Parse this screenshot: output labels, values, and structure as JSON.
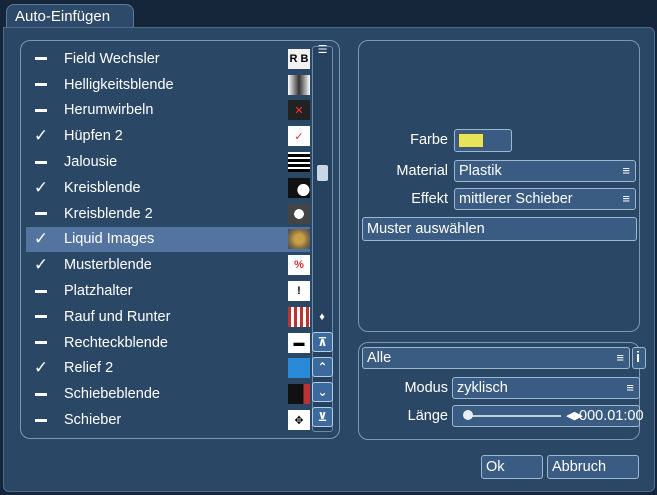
{
  "dialog": {
    "tab_title": "Auto-Einfügen"
  },
  "transitions": [
    {
      "label": "Field Wechsler",
      "enabled": false,
      "thumb": "thumb-rb-icon",
      "thumb_text": "R B"
    },
    {
      "label": "Helligkeitsblende",
      "enabled": false,
      "thumb": "thumb-brightness-icon"
    },
    {
      "label": "Herumwirbeln",
      "enabled": false,
      "thumb": "thumb-swirl-icon"
    },
    {
      "label": "Hüpfen 2",
      "enabled": true,
      "thumb": "thumb-hop-icon"
    },
    {
      "label": "Jalousie",
      "enabled": false,
      "thumb": "thumb-blinds-icon"
    },
    {
      "label": "Kreisblende",
      "enabled": true,
      "thumb": "thumb-circle-icon"
    },
    {
      "label": "Kreisblende 2",
      "enabled": false,
      "thumb": "thumb-circle2-icon"
    },
    {
      "label": "Liquid Images",
      "enabled": true,
      "selected": true,
      "thumb": "thumb-liquid-icon"
    },
    {
      "label": "Musterblende",
      "enabled": true,
      "thumb": "thumb-pattern-icon"
    },
    {
      "label": "Platzhalter",
      "enabled": false,
      "thumb": "thumb-placeholder-icon"
    },
    {
      "label": "Rauf und Runter",
      "enabled": false,
      "thumb": "thumb-updown-icon"
    },
    {
      "label": "Rechteckblende",
      "enabled": false,
      "thumb": "thumb-rect-icon"
    },
    {
      "label": "Relief 2",
      "enabled": true,
      "thumb": "thumb-relief-icon"
    },
    {
      "label": "Schiebeblende",
      "enabled": false,
      "thumb": "thumb-slide-icon"
    },
    {
      "label": "Schieber",
      "enabled": false,
      "thumb": "thumb-pusher-icon"
    }
  ],
  "properties": {
    "farbe_label": "Farbe",
    "farbe_value": "#e8e45a",
    "material_label": "Material",
    "material_value": "Plastik",
    "effekt_label": "Effekt",
    "effekt_value": "mittlerer Schieber",
    "muster_button": "Muster auswählen"
  },
  "bottom": {
    "filter_value": "Alle",
    "info_label": "i",
    "modus_label": "Modus",
    "modus_value": "zyklisch",
    "laenge_label": "Länge",
    "laenge_value": "000.01:00"
  },
  "buttons": {
    "ok": "Ok",
    "cancel": "Abbruch"
  },
  "colors": {
    "background": "#2b4766",
    "selected_row": "#5474a0",
    "swatch": "#e8e45a"
  }
}
